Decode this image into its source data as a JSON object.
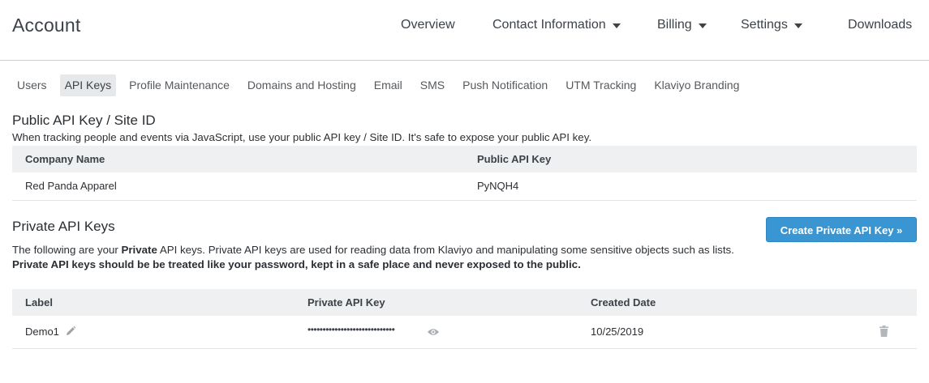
{
  "header": {
    "title": "Account",
    "nav": [
      {
        "label": "Overview",
        "has_menu": false
      },
      {
        "label": "Contact Information",
        "has_menu": true
      },
      {
        "label": "Billing",
        "has_menu": true
      },
      {
        "label": "Settings",
        "has_menu": true
      },
      {
        "label": "Downloads",
        "has_menu": false
      }
    ]
  },
  "subnav": {
    "tabs": [
      "Users",
      "API Keys",
      "Profile Maintenance",
      "Domains and Hosting",
      "Email",
      "SMS",
      "Push Notification",
      "UTM Tracking",
      "Klaviyo Branding"
    ],
    "active": "API Keys"
  },
  "public_key": {
    "title": "Public API Key / Site ID",
    "description": "When tracking people and events via JavaScript, use your public API key / Site ID. It's safe to expose your public API key.",
    "columns": [
      "Company Name",
      "Public API Key"
    ],
    "rows": [
      [
        "Red Panda Apparel",
        "PyNQH4"
      ]
    ]
  },
  "private_keys": {
    "title": "Private API Keys",
    "create_button": "Create Private API Key »",
    "desc_prefix": "The following are your ",
    "desc_bold": "Private",
    "desc_suffix": " API keys. Private API keys are used for reading data from Klaviyo and manipulating some sensitive objects such as lists.",
    "warning": "Private API keys should be be treated like your password, kept in a safe place and never exposed to the public.",
    "columns": [
      "Label",
      "Private API Key",
      "Created Date"
    ],
    "rows": [
      {
        "label": "Demo1",
        "key_masked": "•••••••••••••••••••••••••••••",
        "created": "10/25/2019"
      }
    ]
  },
  "icons": {
    "edit": "pencil-icon",
    "reveal": "eye-icon",
    "delete": "trash-icon",
    "menu": "caret-down-icon"
  },
  "colors": {
    "primary_button": "#3a96d2",
    "table_header_bg": "#eff0f1",
    "active_tab_bg": "#e6e8ea"
  }
}
